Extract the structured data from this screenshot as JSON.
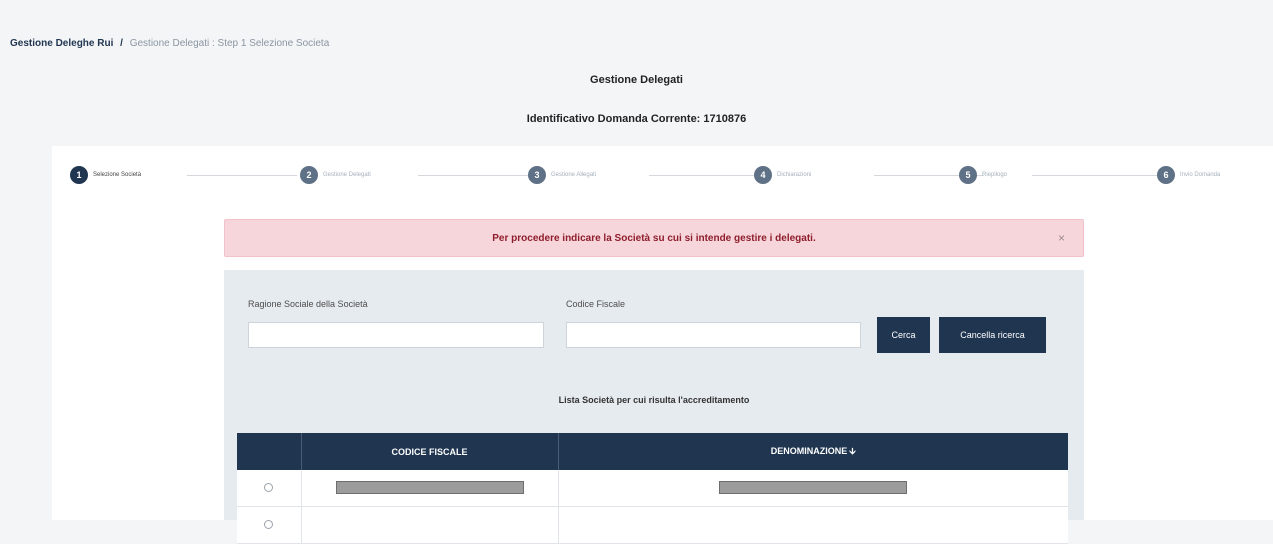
{
  "breadcrumb": {
    "root": "Gestione Deleghe Rui",
    "separator": "/",
    "current": "Gestione Delegati : Step 1 Selezione Societa"
  },
  "header": {
    "title": "Gestione Delegati",
    "subtitle": "Identificativo Domanda Corrente: 1710876"
  },
  "steps": [
    {
      "number": "1",
      "label": "Selezione Società"
    },
    {
      "number": "2",
      "label": "Gestione Delegati"
    },
    {
      "number": "3",
      "label": "Gestione Allegati"
    },
    {
      "number": "4",
      "label": "Dichiarazioni"
    },
    {
      "number": "5",
      "label": "Riepilogo"
    },
    {
      "number": "6",
      "label": "Invio Domanda"
    }
  ],
  "alert": {
    "message": "Per procedere indicare la Società su cui si intende gestire i delegati.",
    "close": "×"
  },
  "search": {
    "ragione_label": "Ragione Sociale della Società",
    "ragione_value": "",
    "codice_label": "Codice Fiscale",
    "codice_value": "",
    "search_button": "Cerca",
    "clear_button": "Cancella ricerca"
  },
  "list": {
    "title": "Lista Società per cui risulta l'accreditamento",
    "columns": [
      "",
      "CODICE FISCALE",
      "DENOMINAZIONE"
    ],
    "sort_icon": "arrow-down-icon"
  },
  "colors": {
    "primary": "#1f3550",
    "alert_bg": "#f6d6db",
    "alert_text": "#8f1d2c",
    "panel_bg": "#e6ebf0"
  }
}
